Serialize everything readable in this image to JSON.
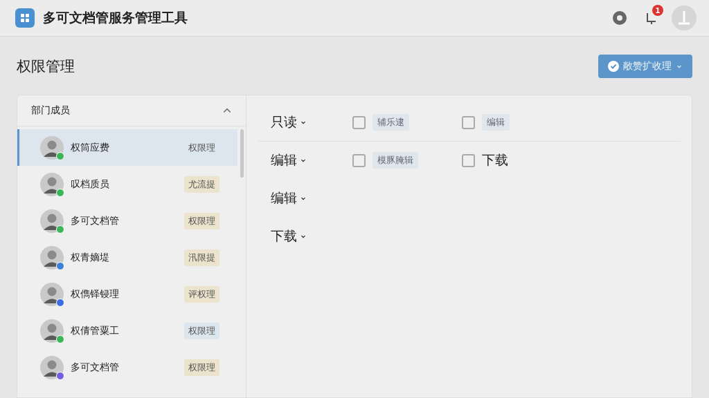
{
  "app": {
    "title": "多可文档管服务管理工具",
    "notification_count": "1"
  },
  "page": {
    "title": "权限管理",
    "action_button": "敞赞扩收理"
  },
  "members": {
    "title": "部门成员",
    "expanded": true,
    "items": [
      {
        "name": "权筒应费",
        "tag": {
          "label": "权限理",
          "color": "#dce6ee"
        },
        "color": "#3cb55a",
        "selected": true
      },
      {
        "name": "叹档质员",
        "tag": {
          "label": "尤流提",
          "color": "#ece3cc"
        },
        "color": "#3cb55a",
        "selected": false
      },
      {
        "name": "多可文档管",
        "tag": {
          "label": "权限理",
          "color": "#ece3cc"
        },
        "color": "#3cb55a",
        "selected": false
      },
      {
        "name": "权青嫡堤",
        "tag": {
          "label": "汛限提",
          "color": "#ece3cc"
        },
        "color": "#3a7fd8",
        "selected": false
      },
      {
        "name": "权儁铎锓理",
        "tag": {
          "label": "评权理",
          "color": "#ece3cc"
        },
        "color": "#3a6ee0",
        "selected": false
      },
      {
        "name": "权倩管粟工",
        "tag": {
          "label": "权限理",
          "color": "#dce6ee"
        },
        "color": "#3cb55a",
        "selected": false
      },
      {
        "name": "多可文档管",
        "tag": {
          "label": "权限理",
          "color": "#ece3cc"
        },
        "color": "#7060e0",
        "selected": false
      }
    ]
  },
  "permissions": [
    {
      "label": "只读",
      "options": [
        {
          "label": "辅乐逮",
          "kind": "chip",
          "checked": false
        },
        {
          "label": "编辑",
          "kind": "chip",
          "checked": false
        }
      ]
    },
    {
      "label": "编辑",
      "options": [
        {
          "label": "模豚腌辑",
          "kind": "chip",
          "checked": false
        },
        {
          "label": "下载",
          "kind": "plain",
          "checked": false
        }
      ]
    },
    {
      "label": "编辑"
    },
    {
      "label": "下载"
    }
  ]
}
